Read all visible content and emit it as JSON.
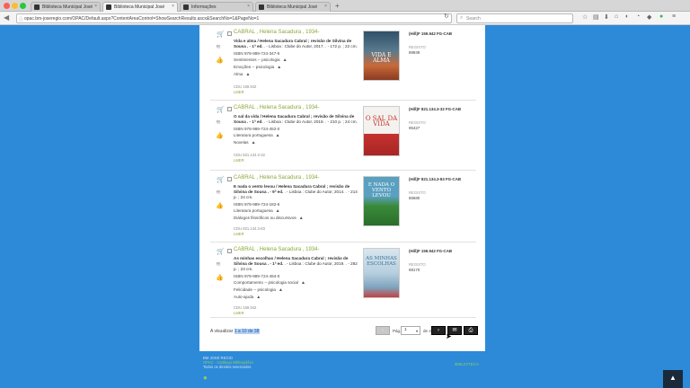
{
  "browser": {
    "tabs": [
      {
        "label": "Biblioteca Municipal José"
      },
      {
        "label": "Biblioteca Municipal José"
      },
      {
        "label": "Informações"
      },
      {
        "label": "Biblioteca Municipal José"
      }
    ],
    "url": "opac.bm-joseregio.com/OPAC/Default.aspx?ContentAreaControl=ShowSearchResults.ascx&SearchNo=1&PageNo=1",
    "search_placeholder": "Search"
  },
  "results": [
    {
      "author": "CABRAL , Helena Sacadura , 1934-",
      "title_bold": "Vida e alma / Helena Sacadura Cabral ; revisão de Silvina de Sousa . - 1ª ed.",
      "title_rest": " . - Lisboa : Clube do Autor, 2017. . - 172 p. ; 22 cm.",
      "isbn": "ISBN 978-989-724-347-5",
      "subjects": [
        "Sentimentos -- psicologia",
        "Emoções -- psicologia",
        "Alma"
      ],
      "cdu": "CDU 159.942",
      "lerm": "LMER",
      "cota": "(Hiß)F 159.942 FG-CAB",
      "registo_label": "REGISTO",
      "registo": "89939",
      "cover_text": "VIDA E ALMA"
    },
    {
      "author": "CABRAL , Helena Sacadura , 1934-",
      "title_bold": "O sal da vida / Helena Sacadura Cabral ; revisão de Silvina de Sousa . - 1ª ed.",
      "title_rest": " . - Lisboa : Clube do Autor, 2018. . - 210 p. ; 24 cm.",
      "isbn": "ISBN 978-989-724-452-0",
      "subjects": [
        "Literatura portuguesa",
        "Novelas"
      ],
      "cdu": "CDU 821.134.3-32",
      "lerm": "LMER",
      "cota": "(Hiß)F 821.134.3-32 FG-CAB",
      "registo_label": "REGISTO",
      "registo": "95427",
      "cover_text": "O SAL DA VIDA"
    },
    {
      "author": "CABRAL , Helena Sacadura , 1934-",
      "title_bold": "E nada o vento levou / Helena Sacadura Cabral ; revisão de Silvina de Sousa . - 9ª ed.",
      "title_rest": " . - Lisboa : Clube do Autor, 2014. . - 214 p. ; 24 cm.",
      "isbn": "ISBN 978-989-724-182-6",
      "subjects": [
        "Literatura portuguesa",
        "Diálogos filosóficos ou discursivos"
      ],
      "cdu": "CDU 821.134.3-83",
      "lerm": "LMER",
      "cota": "(Hiß)F 821.134.3-83 FG-CAB",
      "registo_label": "REGISTO",
      "registo": "86580",
      "cover_text": "E NADA O VENTO LEVOU"
    },
    {
      "author": "CABRAL , Helena Sacadura , 1934-",
      "title_bold": "As minhas escolhas / Helena Sacadura Cabral ; revisão de Silvina de Sousa . - 1ª ed.",
      "title_rest": " . - Lisboa : Clube do Autor, 2019. . - 282 p. ; 23 cm.",
      "isbn": "ISBN 978-989-724-494-0",
      "subjects": [
        "Comportamento -- psicologia social",
        "Felicidade -- psicologia",
        "Auto-ajuda"
      ],
      "cdu": "CDU 159.942",
      "lerm": "LMER",
      "cota": "(Hiß)F 159.942 FG-CAB",
      "registo_label": "REGISTO",
      "registo": "98170",
      "cover_text": "AS MINHAS ESCOLHAS"
    }
  ],
  "pager": {
    "visualizar_label": "A visualizar ",
    "visualizar_range": "1 a 10 de 38",
    "pag_label": "Pág.",
    "current_page": "1",
    "de_label": "de 4"
  },
  "footer": {
    "line1": "BM JOSÉ REGIO",
    "line2": "OPAC · Catálogo Bibliográfico",
    "line3": "Todos os direitos reservados",
    "right": "BIBLIOTECA"
  },
  "colors": {
    "background": "#2c8ad8",
    "author_link": "#8aa83a"
  }
}
